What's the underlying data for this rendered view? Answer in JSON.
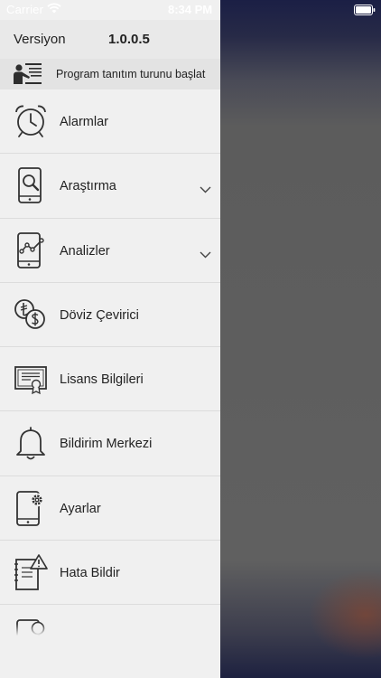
{
  "status_bar": {
    "carrier": "Carrier",
    "time": "8:34 PM",
    "wifi_icon": "wifi-icon",
    "battery_icon": "battery-icon"
  },
  "header": {
    "version_label": "Versiyon",
    "version_value": "1.0.0.5"
  },
  "tour": {
    "label": "Program tanıtım turunu başlat",
    "icon": "presenter-icon"
  },
  "menu": {
    "items": [
      {
        "label": "Alarmlar",
        "icon": "alarm-clock-icon",
        "expandable": false
      },
      {
        "label": "Araştırma",
        "icon": "phone-search-icon",
        "expandable": true
      },
      {
        "label": "Analizler",
        "icon": "phone-chart-icon",
        "expandable": true
      },
      {
        "label": "Döviz Çevirici",
        "icon": "currency-exchange-icon",
        "expandable": false
      },
      {
        "label": "Lisans Bilgileri",
        "icon": "certificate-icon",
        "expandable": false
      },
      {
        "label": "Bildirim Merkezi",
        "icon": "bell-icon",
        "expandable": false
      },
      {
        "label": "Ayarlar",
        "icon": "phone-settings-icon",
        "expandable": false
      },
      {
        "label": "Hata Bildir",
        "icon": "report-error-icon",
        "expandable": false
      }
    ]
  },
  "colors": {
    "drawer_bg": "#f0f0f0",
    "header_bg": "#e9e9e9",
    "icon_stroke": "#333333"
  }
}
